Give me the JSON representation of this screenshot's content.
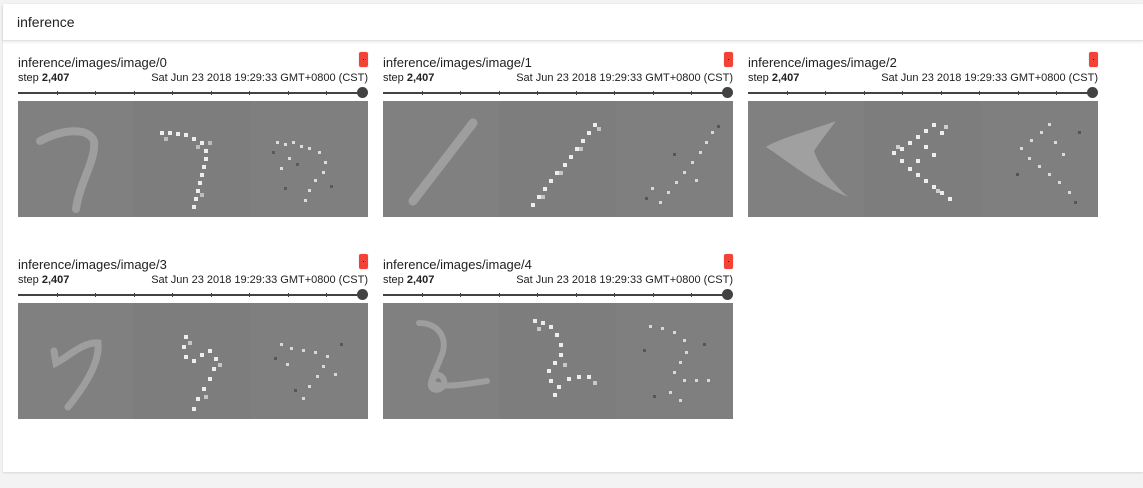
{
  "header": {
    "title": "inference"
  },
  "cards": [
    {
      "title": "inference/images/image/0",
      "step_label": "step",
      "step": "2,407",
      "time": "Sat Jun 23 2018 19:29:33 GMT+0800 (CST)",
      "digit": "7"
    },
    {
      "title": "inference/images/image/1",
      "step_label": "step",
      "step": "2,407",
      "time": "Sat Jun 23 2018 19:29:33 GMT+0800 (CST)",
      "digit": "1"
    },
    {
      "title": "inference/images/image/2",
      "step_label": "step",
      "step": "2,407",
      "time": "Sat Jun 23 2018 19:29:33 GMT+0800 (CST)",
      "digit": "<"
    },
    {
      "title": "inference/images/image/3",
      "step_label": "step",
      "step": "2,407",
      "time": "Sat Jun 23 2018 19:29:33 GMT+0800 (CST)",
      "digit": "7"
    },
    {
      "title": "inference/images/image/4",
      "step_label": "step",
      "step": "2,407",
      "time": "Sat Jun 23 2018 19:29:33 GMT+0800 (CST)",
      "digit": "2"
    }
  ],
  "colors": {
    "badge": "#f44336",
    "slider": "#424242",
    "image_bg": "#808080"
  }
}
